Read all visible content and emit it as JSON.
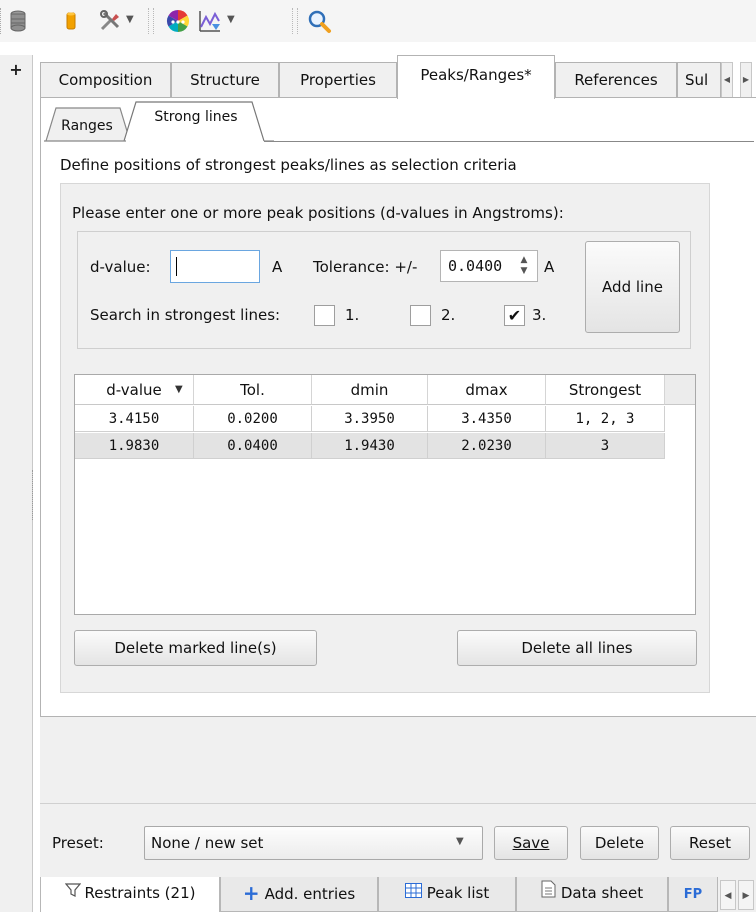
{
  "toolbar": {
    "icons": [
      "database-icon",
      "cylinder-icon",
      "tools-icon",
      "color-wheel-icon",
      "chart-picker-icon",
      "search-icon"
    ]
  },
  "left_panel": {
    "expand_label": "+"
  },
  "main_tabs": [
    {
      "label": "Composition"
    },
    {
      "label": "Structure"
    },
    {
      "label": "Properties"
    },
    {
      "label": "Peaks/Ranges*",
      "active": true
    },
    {
      "label": "References"
    },
    {
      "label": "Sul"
    }
  ],
  "sub_tabs": [
    {
      "label": "Ranges"
    },
    {
      "label": "Strong lines",
      "active": true
    }
  ],
  "description": "Define positions of strongest peaks/lines as selection criteria",
  "group": {
    "prompt": "Please enter one or more peak positions (d-values in Angstroms):",
    "dvalue_label": "d-value:",
    "dvalue_value": "",
    "dvalue_unit": "A",
    "tolerance_label": "Tolerance: +/-",
    "tolerance_value": "0.0400",
    "tolerance_unit": "A",
    "add_line_label": "Add line",
    "search_label": "Search in strongest lines:",
    "checkboxes": [
      {
        "label": "1.",
        "checked": false
      },
      {
        "label": "2.",
        "checked": false
      },
      {
        "label": "3.",
        "checked": true,
        "mark": "✔"
      }
    ]
  },
  "table": {
    "headers": [
      "d-value",
      "Tol.",
      "dmin",
      "dmax",
      "Strongest"
    ],
    "rows": [
      [
        "3.4150",
        "0.0200",
        "3.3950",
        "3.4350",
        "1, 2, 3"
      ],
      [
        "1.9830",
        "0.0400",
        "1.9430",
        "2.0230",
        "3"
      ]
    ]
  },
  "actions": {
    "delete_marked_label": "Delete marked line(s)",
    "delete_all_label": "Delete all lines"
  },
  "preset": {
    "label": "Preset:",
    "value": "None / new set",
    "save_label": "Save",
    "delete_label": "Delete",
    "reset_label": "Reset"
  },
  "bottom_tabs": [
    {
      "label": "Restraints (21)",
      "icon": "filter-icon",
      "active": true
    },
    {
      "label": "Add. entries",
      "icon": "plus-icon"
    },
    {
      "label": "Peak list",
      "icon": "table-icon"
    },
    {
      "label": "Data sheet",
      "icon": "document-icon"
    },
    {
      "label": "FP",
      "icon": "fp-icon"
    }
  ],
  "colors": {
    "accent_blue": "#2b6cd6",
    "panel_bg": "#f0f0f0",
    "selected_row": "#e3e3e3"
  }
}
